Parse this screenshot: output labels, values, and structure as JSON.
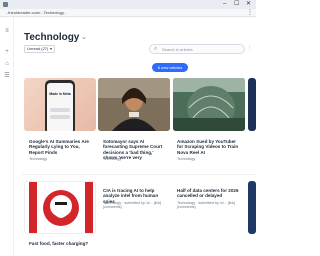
{
  "browser": {
    "url": "..theoldreader.com/...Technology..",
    "controls": {
      "minimize": "–",
      "maximize": "☐",
      "close": "✕"
    },
    "menu": "⋮"
  },
  "page": {
    "title": "Technology",
    "filter_label": "Unread (27)",
    "search_placeholder": "Search in articles",
    "new_articles_label": "6 new articles"
  },
  "cards": [
    {
      "title": "Google's AI Summaries Are Regularly Lying to You, Report Finds",
      "meta": "Technology"
    },
    {
      "title": "Sotomayor says AI forecasting Supreme Court decisions a 'bad thing,' shows 'we're very",
      "meta": "Technology"
    },
    {
      "title": "Amazon Sued by YouTuber for Scraping Videos to Train Nova Reel AI",
      "meta": "Technology"
    },
    {
      "title": "",
      "meta": ""
    },
    {
      "title": "Fast food, faster charging?",
      "meta": ""
    },
    {
      "title": "CIA is tracing AI to help analyze intel from human spies",
      "meta": "Technology · submitted by /u/...  [link]  [comments]"
    },
    {
      "title": "Half of data centers for 2026 cancelled or delayed",
      "meta": "Technology · submitted by /u/...  [link]  [comments]"
    }
  ],
  "phone_screen": {
    "label": "Made in Meta"
  },
  "colors": {
    "accent": "#2f6bff",
    "text": "#1d2a3a",
    "muted": "#6b7785"
  }
}
